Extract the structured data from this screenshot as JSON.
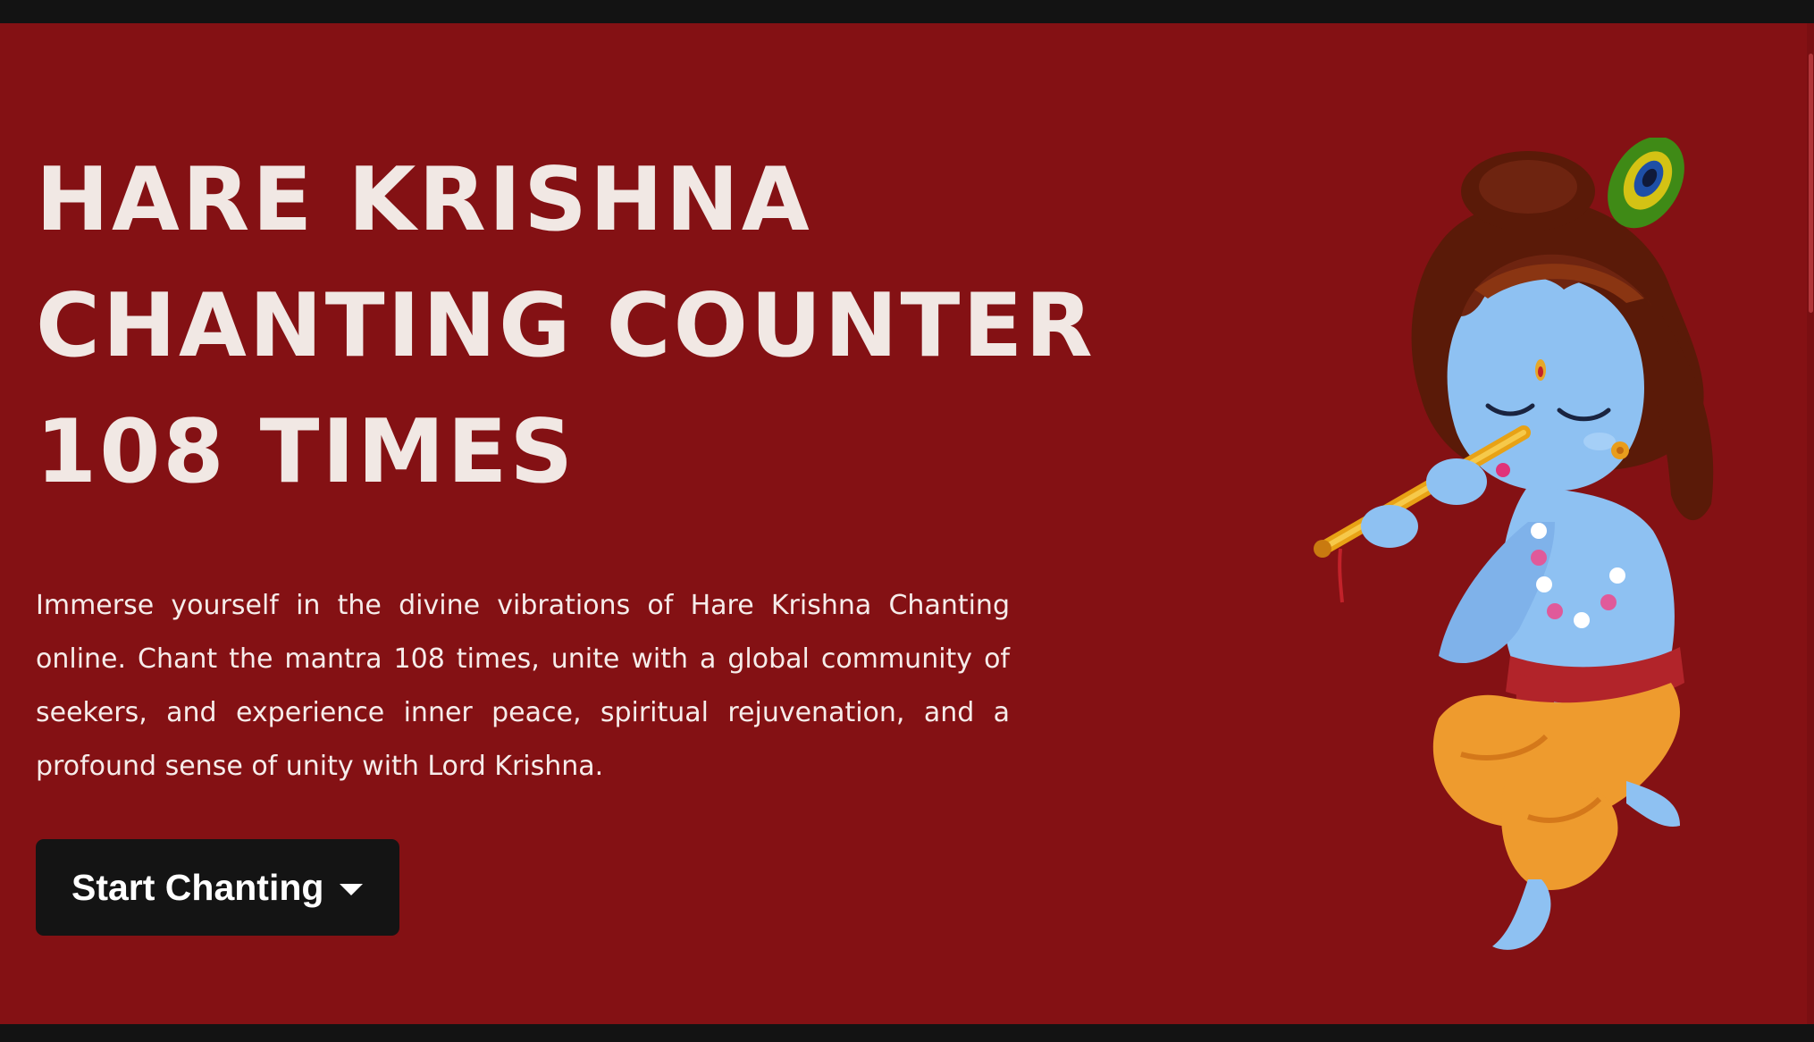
{
  "hero": {
    "title_lines": [
      "HARE KRISHNA",
      "CHANTING COUNTER",
      "108 TIMES"
    ],
    "description": "Immerse yourself in the divine vibrations of Hare Krishna Chanting online. Chant the mantra 108 times, unite with a global community of seekers, and experience inner peace, spiritual rejuvenation, and a profound sense of unity with Lord Krishna.",
    "cta_label": "Start Chanting",
    "cta_icon": "caret-down-icon",
    "illustration": "krishna-flute-illustration"
  },
  "colors": {
    "hero_background": "#841114",
    "page_frame": "#131313",
    "heading_text": "#f1e8e4",
    "button_background": "#141414",
    "button_text": "#ffffff"
  }
}
